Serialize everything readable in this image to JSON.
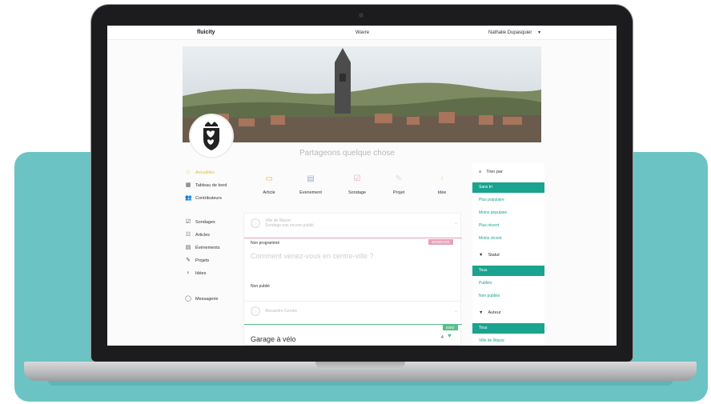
{
  "topbar": {
    "logo": "fluicity",
    "city": "Wavre",
    "user": "Nathalie Dupasquier"
  },
  "share_prompt": "Partageons quelque chose",
  "nav": {
    "items": [
      {
        "label": "Actualités",
        "icon": "star-icon",
        "active": true
      },
      {
        "label": "Tableau de bord",
        "icon": "dashboard-icon"
      },
      {
        "label": "Contributeurs",
        "icon": "users-icon"
      },
      {
        "label": "Sondages",
        "icon": "poll-icon"
      },
      {
        "label": "Articles",
        "icon": "article-icon"
      },
      {
        "label": "Événements",
        "icon": "calendar-icon"
      },
      {
        "label": "Projets",
        "icon": "pencil-icon"
      },
      {
        "label": "Idées",
        "icon": "bulb-icon"
      },
      {
        "label": "Messagerie",
        "icon": "chat-icon"
      }
    ]
  },
  "actions": [
    {
      "label": "Article",
      "icon": "article-icon",
      "color": "#f0b52a"
    },
    {
      "label": "Evenement",
      "icon": "calendar-icon",
      "color": "#9ab0d8"
    },
    {
      "label": "Sondage",
      "icon": "poll-icon",
      "color": "#e7a1b8"
    },
    {
      "label": "Projet",
      "icon": "pencil-icon",
      "color": "#cfe3df"
    },
    {
      "label": "Idée",
      "icon": "bulb-icon",
      "color": "#d7e7a8"
    }
  ],
  "cards": {
    "poll": {
      "author": "Ville de Wavre",
      "subtitle": "Sondage pas encore publié",
      "state": "Non programmé",
      "tag": "SONDAGE",
      "tag_color": "#e7a1b8",
      "question": "Comment venez-vous en centre-ville ?",
      "footer": "Non publié"
    },
    "idea": {
      "author": "Alexandre Gerelle",
      "tag": "IDEE",
      "tag_color": "#58c08a",
      "title": "Garage à vélo",
      "count": "4"
    }
  },
  "filters": {
    "sort": {
      "title": "Trier par",
      "options": [
        "Sans tri",
        "Plus populaire",
        "Moins populaire",
        "Plus récent",
        "Moins récent"
      ],
      "selected": 0
    },
    "status": {
      "title": "Statut",
      "options": [
        "Tous",
        "Publiés",
        "Non publiés"
      ],
      "selected": 0
    },
    "author": {
      "title": "Auteur",
      "options": [
        "Tous",
        "Ville de Wavre"
      ],
      "selected": 0
    }
  },
  "colors": {
    "teal_card": "#6cc3c3",
    "accent_green": "#1aa38f",
    "active_nav": "#f0b52a"
  }
}
